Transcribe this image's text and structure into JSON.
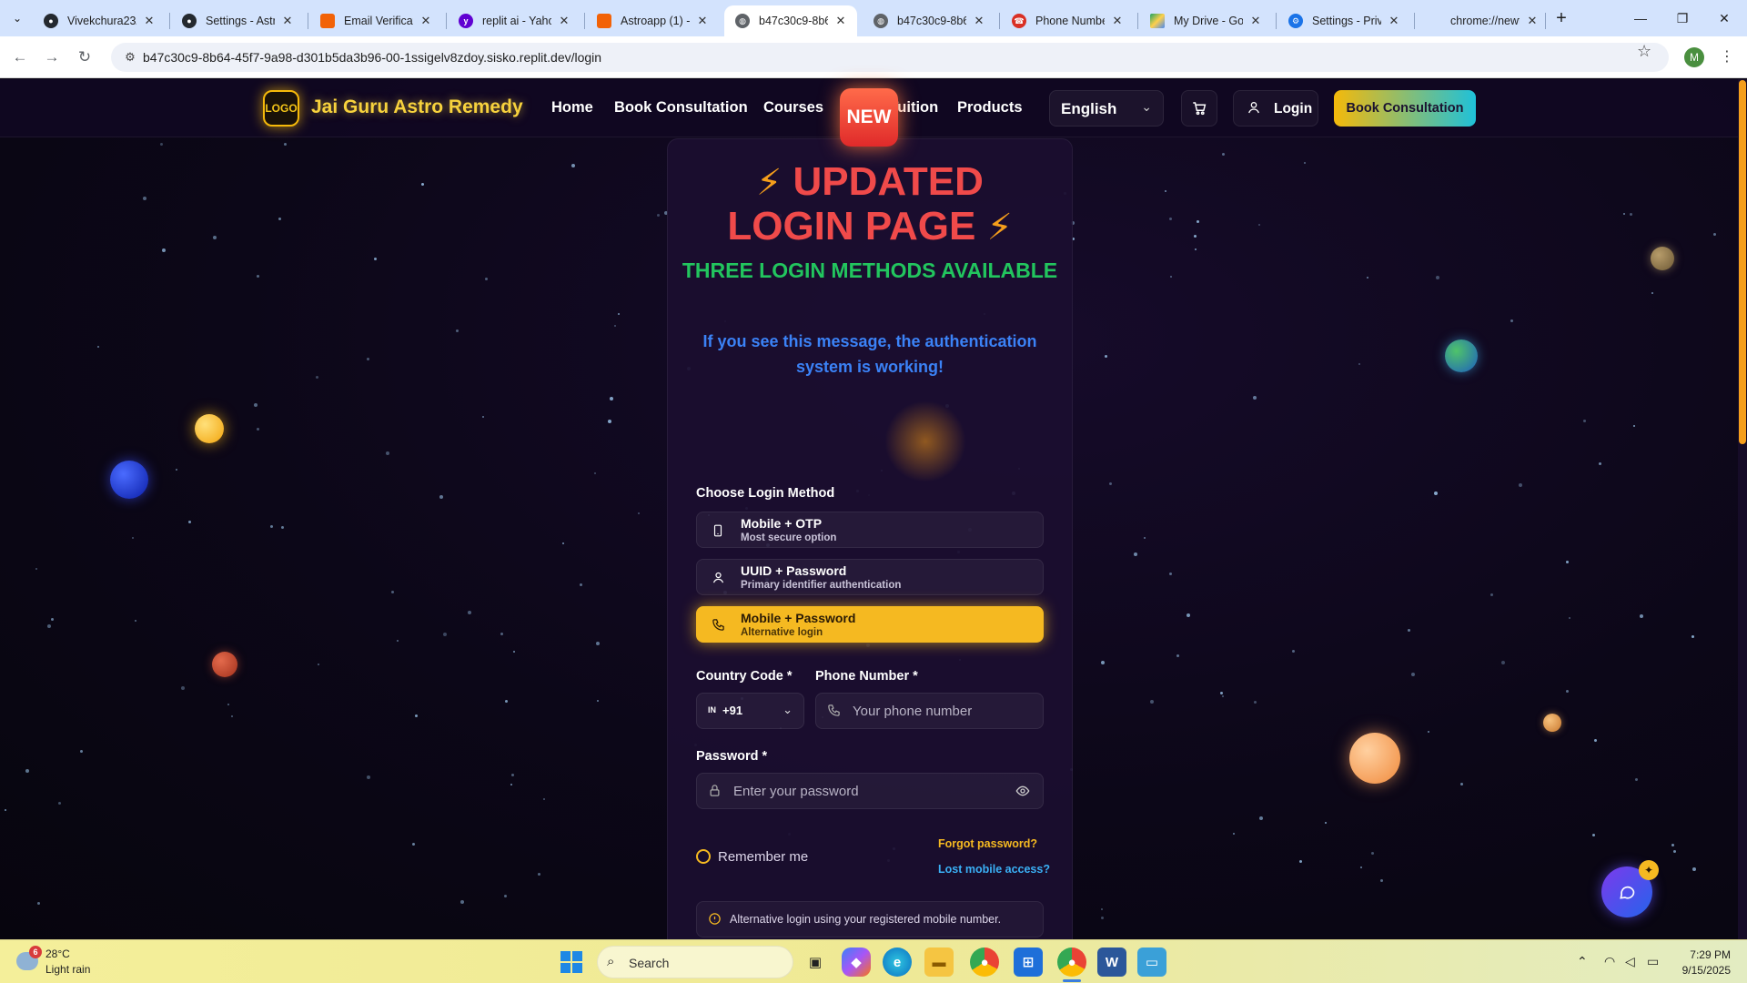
{
  "browser": {
    "tabs": [
      {
        "title": "Vivekchura23/...",
        "favicon": "github-icon",
        "color": "#24292f"
      },
      {
        "title": "Settings - Astr...",
        "favicon": "github-icon",
        "color": "#24292f"
      },
      {
        "title": "Email Verificati...",
        "favicon": "replit-icon",
        "color": "#f26207"
      },
      {
        "title": "replit ai - Yaho...",
        "favicon": "yahoo-icon",
        "color": "#6001d2"
      },
      {
        "title": "Astroapp (1) - ...",
        "favicon": "replit-icon",
        "color": "#f26207"
      },
      {
        "title": "b47c30c9-8b6...",
        "favicon": "globe-icon",
        "color": "#5f6368"
      },
      {
        "title": "b47c30c9-8b6...",
        "favicon": "globe-icon",
        "color": "#5f6368"
      },
      {
        "title": "Phone Number...",
        "favicon": "phone-lookup-icon",
        "color": "#d93025"
      },
      {
        "title": "My Drive - Goo...",
        "favicon": "google-drive-icon",
        "color": "#1fa463"
      },
      {
        "title": "Settings - Priva...",
        "favicon": "gear-icon",
        "color": "#1a73e8"
      },
      {
        "title": "chrome://newt...",
        "favicon": "",
        "color": ""
      }
    ],
    "active_tab_index": 5,
    "url": "b47c30c9-8b64-45f7-9a98-d301b5da3b96-00-1ssigelv8zdoy.sisko.replit.dev/login",
    "profile_initial": "M"
  },
  "site": {
    "logo_text": "LOGO",
    "brand": "Jai Guru Astro Remedy",
    "nav": [
      "Home",
      "Book Consultation",
      "Courses",
      "Home Tuition",
      "Products"
    ],
    "language": "English",
    "login_label": "Login",
    "book_label": "Book Consultation"
  },
  "login": {
    "badge": "NEW",
    "headline_line1": "UPDATED",
    "headline_line2": "LOGIN PAGE",
    "subhead": "THREE LOGIN METHODS AVAILABLE",
    "info": "If you see this message, the authentication system is working!",
    "choose_label": "Choose Login Method",
    "methods": [
      {
        "title": "Mobile + OTP",
        "subtitle": "Most secure option",
        "icon": "smartphone-icon",
        "selected": false
      },
      {
        "title": "UUID + Password",
        "subtitle": "Primary identifier authentication",
        "icon": "user-icon",
        "selected": false
      },
      {
        "title": "Mobile + Password",
        "subtitle": "Alternative login",
        "icon": "phone-icon",
        "selected": true
      }
    ],
    "country_code_label": "Country Code *",
    "country_flag": "IN",
    "country_code_value": "+91",
    "phone_label": "Phone Number *",
    "phone_placeholder": "Your phone number",
    "password_label": "Password *",
    "password_placeholder": "Enter your password",
    "remember_label": "Remember me",
    "forgot_label": "Forgot password?",
    "lost_label": "Lost mobile access?",
    "alert_text": "Alternative login using your registered mobile number."
  },
  "taskbar": {
    "weather_badge": "6",
    "weather_temp": "28°C",
    "weather_desc": "Light rain",
    "search_label": "Search",
    "time": "7:29 PM",
    "date": "9/15/2025"
  },
  "colors": {
    "accent_gold": "#f5b921",
    "headline_red": "#f04a4a",
    "subhead_green": "#22c55e",
    "info_blue": "#3b82f6"
  }
}
